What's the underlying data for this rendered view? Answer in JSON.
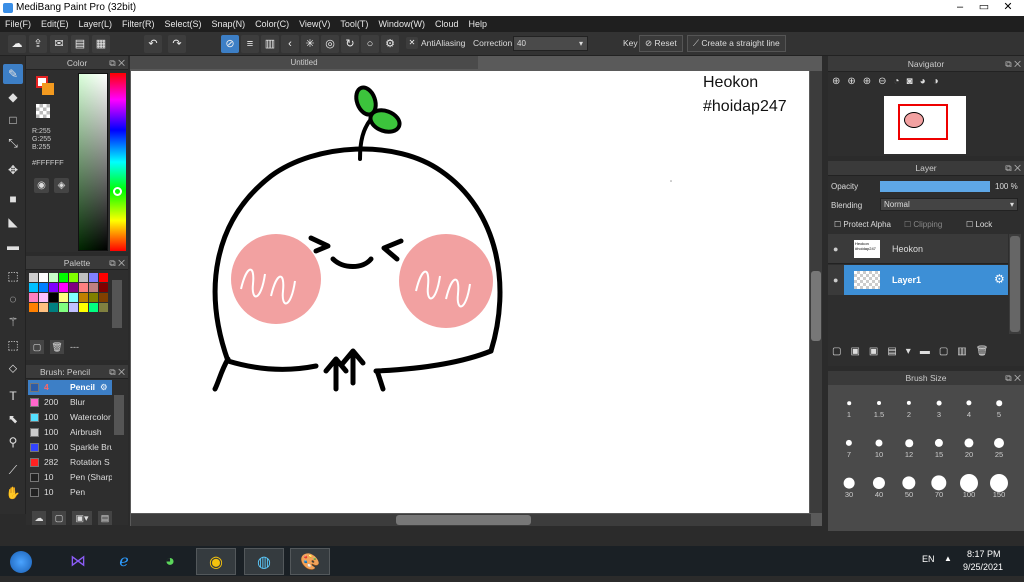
{
  "window": {
    "title": "MediBang Paint Pro (32bit)"
  },
  "menu": [
    "File(F)",
    "Edit(E)",
    "Layer(L)",
    "Filter(R)",
    "Select(S)",
    "Snap(N)",
    "Color(C)",
    "View(V)",
    "Tool(T)",
    "Window(W)",
    "Cloud",
    "Help"
  ],
  "toolbar": {
    "antialiasing": "AntiAliasing",
    "correction_label": "Correction",
    "correction_value": "40",
    "key_label": "Key",
    "reset_label": "Reset",
    "straight_line_label": "Create a straight line"
  },
  "color_panel": {
    "title": "Color",
    "r": "R:255",
    "g": "G:255",
    "b": "B:255",
    "hex": "#FFFFFF",
    "fg": "#e52222",
    "fg2": "#f39a1f"
  },
  "palette_panel": {
    "title": "Palette",
    "dash": "---",
    "swatches": [
      "#cfcfcf",
      "#ffffff",
      "#c8ffc8",
      "#00ff00",
      "#80ff00",
      "#c0c0c0",
      "#8080ff",
      "#ff0000",
      "#00c0ff",
      "#0080ff",
      "#8000ff",
      "#ff00ff",
      "#800080",
      "#ff8080",
      "#c08080",
      "#800000",
      "#ff80c0",
      "#ffc0ff",
      "#000000",
      "#ffff80",
      "#80ffff",
      "#c08000",
      "#808000",
      "#804000",
      "#ff8000",
      "#ffc080",
      "#008080",
      "#80ff80",
      "#c0c0ff",
      "#ffff00",
      "#00ff80",
      "#808040"
    ]
  },
  "brush_panel": {
    "title": "Brush: Pencil",
    "items": [
      {
        "size": "4",
        "name": "Pencil",
        "color": "#2c5ca8"
      },
      {
        "size": "200",
        "name": "Blur",
        "color": "#ff66cc"
      },
      {
        "size": "100",
        "name": "Watercolor",
        "color": "#55e0ff"
      },
      {
        "size": "100",
        "name": "Airbrush",
        "color": "#cccccc"
      },
      {
        "size": "100",
        "name": "Sparkle Brush",
        "color": "#3344ff"
      },
      {
        "size": "282",
        "name": "Rotation S",
        "color": "#ff2222"
      },
      {
        "size": "10",
        "name": "Pen (Sharp)",
        "color": "#222222"
      },
      {
        "size": "10",
        "name": "Pen",
        "color": "#222222"
      }
    ]
  },
  "canvas": {
    "tab": "Untitled",
    "text1": "Heokon",
    "text2": "#hoidap247"
  },
  "navigator": {
    "title": "Navigator"
  },
  "layer_panel": {
    "title": "Layer",
    "opacity_label": "Opacity",
    "opacity_value": "100 %",
    "opacity_fraction": 1.0,
    "blending_label": "Blending",
    "blending_value": "Normal",
    "protect_alpha": "Protect Alpha",
    "clipping": "Clipping",
    "lock": "Lock",
    "layers": [
      {
        "name": "Heokon",
        "thumb": "Heokon #hoidap247"
      },
      {
        "name": "Layer1"
      }
    ]
  },
  "brush_size_panel": {
    "title": "Brush Size",
    "sizes": [
      "1",
      "1.5",
      "2",
      "3",
      "4",
      "5",
      "7",
      "10",
      "12",
      "15",
      "20",
      "25",
      "30",
      "40",
      "50",
      "70",
      "100",
      "150"
    ]
  },
  "taskbar": {
    "lang": "EN",
    "time": "8:17 PM",
    "date": "9/25/2021"
  }
}
